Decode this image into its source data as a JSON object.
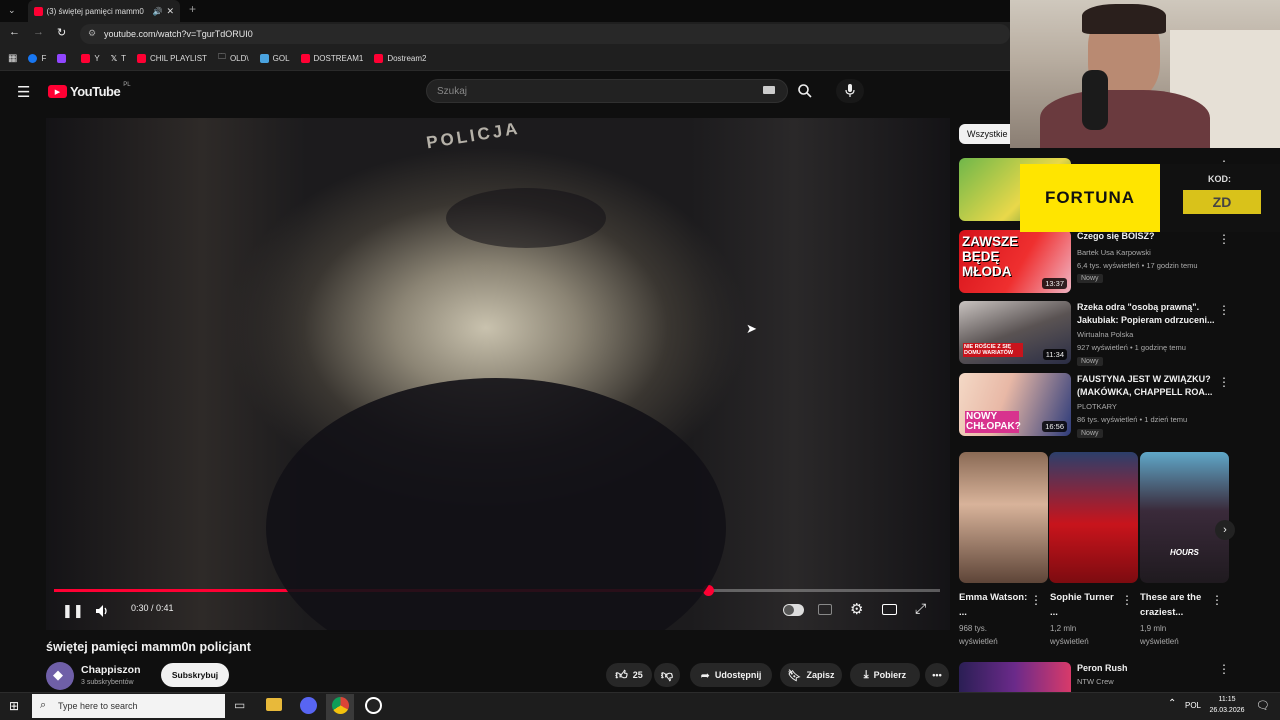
{
  "browser": {
    "tab_title": "(3) świętej pamięci mamm0",
    "url": "youtube.com/watch?v=TgurTdORUI0",
    "bookmarks": [
      {
        "label": "F",
        "color": "#1877f2"
      },
      {
        "label": "",
        "color": "#9146ff"
      },
      {
        "label": "Y",
        "color": "#ff0033"
      },
      {
        "label": "T",
        "color": "#ffffff"
      },
      {
        "label": "CHIL PLAYLIST",
        "color": "#ff0033"
      },
      {
        "label": "OLD\\",
        "color": "#aaaaaa"
      },
      {
        "label": "GOL",
        "color": "#4aa3df"
      },
      {
        "label": "DOSTREAM1",
        "color": "#ff0033"
      },
      {
        "label": "Dostream2",
        "color": "#ff0033"
      }
    ]
  },
  "youtube": {
    "logo": "YouTube",
    "region": "PL",
    "search_placeholder": "Szukaj"
  },
  "player": {
    "time": "0:30 / 0:41",
    "progress": 0.738,
    "watermark": "POLICJA"
  },
  "video": {
    "title": "świętej pamięci mamm0n policjant",
    "channel": "Chappiszon",
    "subscribers": "3 subskrybentów",
    "subscribe_label": "Subskrybuj",
    "likes": "25",
    "share_label": "Udostępnij",
    "save_label": "Zapisz",
    "download_label": "Pobierz"
  },
  "sidebar": {
    "chip": "Wszystkie",
    "recommendations": [
      {
        "title": "Czego się BOISZ?",
        "channel": "Bartek Usa Karpowski",
        "meta": "6,4 tys. wyświetleń • 17 godzin temu",
        "badge": "Nowy",
        "duration": "13:37",
        "thumb_text": "ZAWSZE BĘDĘ MŁODA"
      },
      {
        "title": "Rzeka odra \"osobą prawną\". Jakubiak: Popieram odrzuceni...",
        "channel": "Wirtualna Polska",
        "meta": "927 wyświetleń • 1 godzinę temu",
        "badge": "Nowy",
        "duration": "11:34",
        "thumb_text": "NIE ROŚCIE Z SIĘ DOMU WARIATÓW"
      },
      {
        "title": "FAUSTYNA JEST W ZWIĄZKU? (MAKÓWKA, CHAPPELL ROA...",
        "channel": "PLOTKARY",
        "meta": "86 tys. wyświetleń • 1 dzień temu",
        "badge": "Nowy",
        "duration": "16:56",
        "thumb_text": "NOWY CHŁOPAK?"
      }
    ],
    "shorts": [
      {
        "title": "Emma Watson: ...",
        "views": "968 tys. wyświetleń"
      },
      {
        "title": "Sophie Turner ...",
        "views": "1,2 mln wyświetleń"
      },
      {
        "title": "These are the craziest...",
        "views": "1,9 mln wyświetleń",
        "thumb_text": "HOURS"
      }
    ],
    "next": {
      "title": "Peron Rush",
      "channel": "NTW Crew"
    }
  },
  "ad": {
    "brand": "FORTUNA",
    "kod_label": "KOD:",
    "kod_value": "ZD"
  },
  "taskbar": {
    "search_placeholder": "Type here to search",
    "language": "POL",
    "time": "11:15",
    "date": "26.03.2026"
  }
}
